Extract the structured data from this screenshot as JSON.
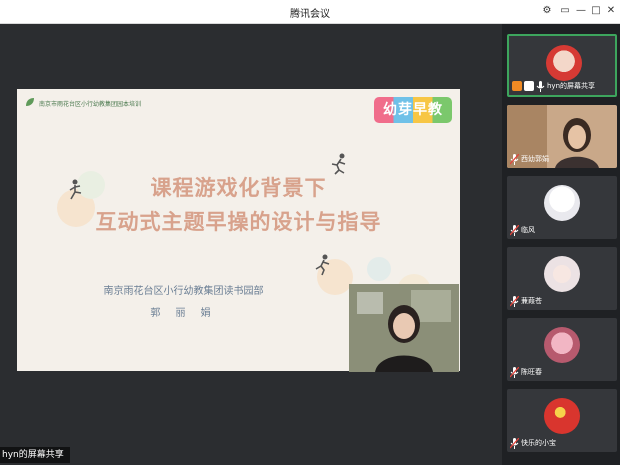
{
  "window": {
    "title": "腾讯会议"
  },
  "slide": {
    "header_text": "南京市雨花台区小行幼教集团园本培训",
    "brand_logo": "幼芽早教",
    "title_line1": "课程游戏化背景下",
    "title_line2": "互动式主题早操的设计与指导",
    "subtitle": "南京雨花台区小行幼教集团读书园部",
    "author": "郭 丽 娟"
  },
  "share_label": "hyn的屏幕共享",
  "participants": [
    {
      "name": "hyn的屏幕共享",
      "avatar": "red-cartoon-avatar",
      "active": true
    },
    {
      "name": "西幼郭娟",
      "avatar": "video-feed"
    },
    {
      "name": "临风",
      "avatar": "cartoon-avatar"
    },
    {
      "name": "蒹葭苍",
      "avatar": "flower-avatar"
    },
    {
      "name": "陈旺春",
      "avatar": "pink-avatar"
    },
    {
      "name": "快乐的小宝",
      "avatar": "flag-avatar"
    }
  ],
  "colors": {
    "accent_green": "#3da55d",
    "mic_red": "#e0443c",
    "title_salmon": "#d8a28c"
  }
}
